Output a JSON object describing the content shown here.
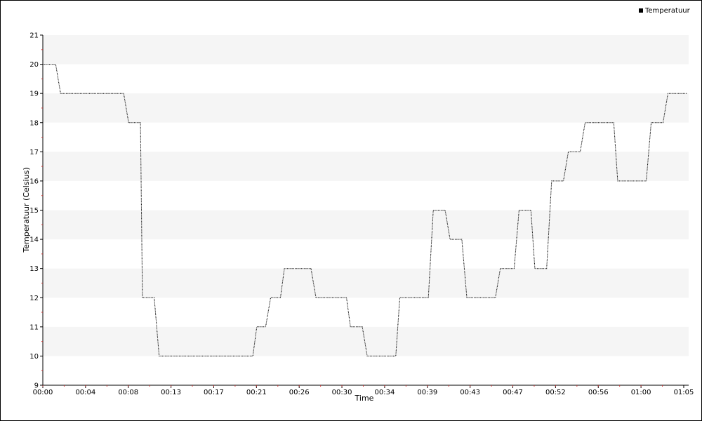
{
  "chart_data": {
    "type": "line",
    "title": "",
    "xlabel": "Time",
    "ylabel": "Temperatuur (Celsius)",
    "xlim": [
      0,
      65.5
    ],
    "ylim": [
      9,
      21
    ],
    "x_tick_labels": [
      "00:00",
      "00:04",
      "00:08",
      "00:13",
      "00:17",
      "00:21",
      "00:26",
      "00:30",
      "00:34",
      "00:39",
      "00:43",
      "00:47",
      "00:52",
      "00:56",
      "01:00",
      "01:05"
    ],
    "x_tick_values": [
      0,
      4.333,
      8.667,
      13,
      17.333,
      21.667,
      26,
      30.333,
      34.667,
      39,
      43.333,
      47.667,
      52,
      56.333,
      60.667,
      65
    ],
    "y_ticks": [
      9,
      10,
      11,
      12,
      13,
      14,
      15,
      16,
      17,
      18,
      19,
      20,
      21
    ],
    "grid": "alternating horizontal bands",
    "legend": {
      "position": "top-right",
      "entries": [
        "Temperatuur"
      ]
    },
    "series": [
      {
        "name": "Temperatuur",
        "color": "#000000",
        "line_style": "dotted step",
        "points": [
          [
            0,
            20
          ],
          [
            1.3,
            20
          ],
          [
            1.8,
            19
          ],
          [
            8.2,
            19
          ],
          [
            8.7,
            18
          ],
          [
            9.9,
            18
          ],
          [
            10.1,
            12
          ],
          [
            11.3,
            12
          ],
          [
            11.8,
            10
          ],
          [
            21.3,
            10
          ],
          [
            21.7,
            11
          ],
          [
            22.6,
            11
          ],
          [
            23.1,
            12
          ],
          [
            24.1,
            12
          ],
          [
            24.5,
            13
          ],
          [
            27.2,
            13
          ],
          [
            27.7,
            12
          ],
          [
            30.8,
            12
          ],
          [
            31.2,
            11
          ],
          [
            32.4,
            11
          ],
          [
            32.9,
            10
          ],
          [
            35.8,
            10
          ],
          [
            36.2,
            12
          ],
          [
            39.1,
            12
          ],
          [
            39.6,
            15
          ],
          [
            40.8,
            15
          ],
          [
            41.3,
            14
          ],
          [
            42.5,
            14
          ],
          [
            43.0,
            12
          ],
          [
            45.9,
            12
          ],
          [
            46.4,
            13
          ],
          [
            47.8,
            13
          ],
          [
            48.3,
            15
          ],
          [
            49.5,
            15
          ],
          [
            49.9,
            13
          ],
          [
            51.1,
            13
          ],
          [
            51.6,
            16
          ],
          [
            52.8,
            16
          ],
          [
            53.3,
            17
          ],
          [
            54.5,
            17
          ],
          [
            55.0,
            18
          ],
          [
            57.9,
            18
          ],
          [
            58.3,
            16
          ],
          [
            61.2,
            16
          ],
          [
            61.7,
            18
          ],
          [
            62.9,
            18
          ],
          [
            63.4,
            19
          ],
          [
            65.3,
            19
          ]
        ]
      }
    ]
  },
  "colors": {
    "band": "#f5f5f5",
    "axis": "#000000",
    "minor_tick": "#cc3333",
    "line": "#000000"
  }
}
